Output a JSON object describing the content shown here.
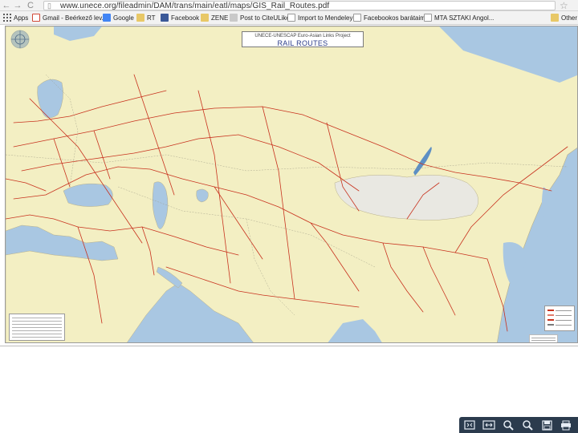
{
  "browser": {
    "back_glyph": "←",
    "forward_glyph": "→",
    "reload_glyph": "C",
    "url": "www.unece.org/fileadmin/DAM/trans/main/eatl/maps/GIS_Rail_Routes.pdf",
    "star_glyph": "☆"
  },
  "bookmarks": {
    "items": [
      {
        "label": "Apps",
        "icon": "apps-grid-icon"
      },
      {
        "label": "Gmail - Beérkező lev...",
        "icon": "gmail-icon"
      },
      {
        "label": "Google",
        "icon": "google-icon"
      },
      {
        "label": "RT",
        "icon": "folder-icon"
      },
      {
        "label": "Facebook",
        "icon": "facebook-icon"
      },
      {
        "label": "ZENE",
        "icon": "folder-icon"
      },
      {
        "label": "Post to CiteULike",
        "icon": "citeulike-icon"
      },
      {
        "label": "Import to Mendeley",
        "icon": "document-icon"
      },
      {
        "label": "Facebookos barátaim",
        "icon": "document-icon"
      },
      {
        "label": "MTA SZTAKI Angol...",
        "icon": "document-icon"
      },
      {
        "label": "Other b",
        "icon": "folder-icon"
      }
    ],
    "overflow_glyph": "»"
  },
  "map": {
    "title_line1": "UNECE-UNESCAP Euro-Asian Links Project",
    "title_line2": "RAIL ROUTES",
    "colors": {
      "land": "#f3efc3",
      "water": "#a9c7e2",
      "rail": "#c8321e",
      "border": "#b8b08a"
    }
  },
  "pdf_toolbar": {
    "buttons": [
      {
        "name": "fit-page-button",
        "icon": "fit-page-icon",
        "glyph": "⛶"
      },
      {
        "name": "fit-width-button",
        "icon": "fit-width-icon",
        "glyph": "↔"
      },
      {
        "name": "zoom-in-button",
        "icon": "zoom-in-icon",
        "glyph": "🔍"
      },
      {
        "name": "zoom-out-button",
        "icon": "zoom-out-icon",
        "glyph": "🔍"
      },
      {
        "name": "save-button",
        "icon": "save-icon",
        "glyph": "💾"
      },
      {
        "name": "print-button",
        "icon": "print-icon",
        "glyph": "🖶"
      }
    ]
  }
}
